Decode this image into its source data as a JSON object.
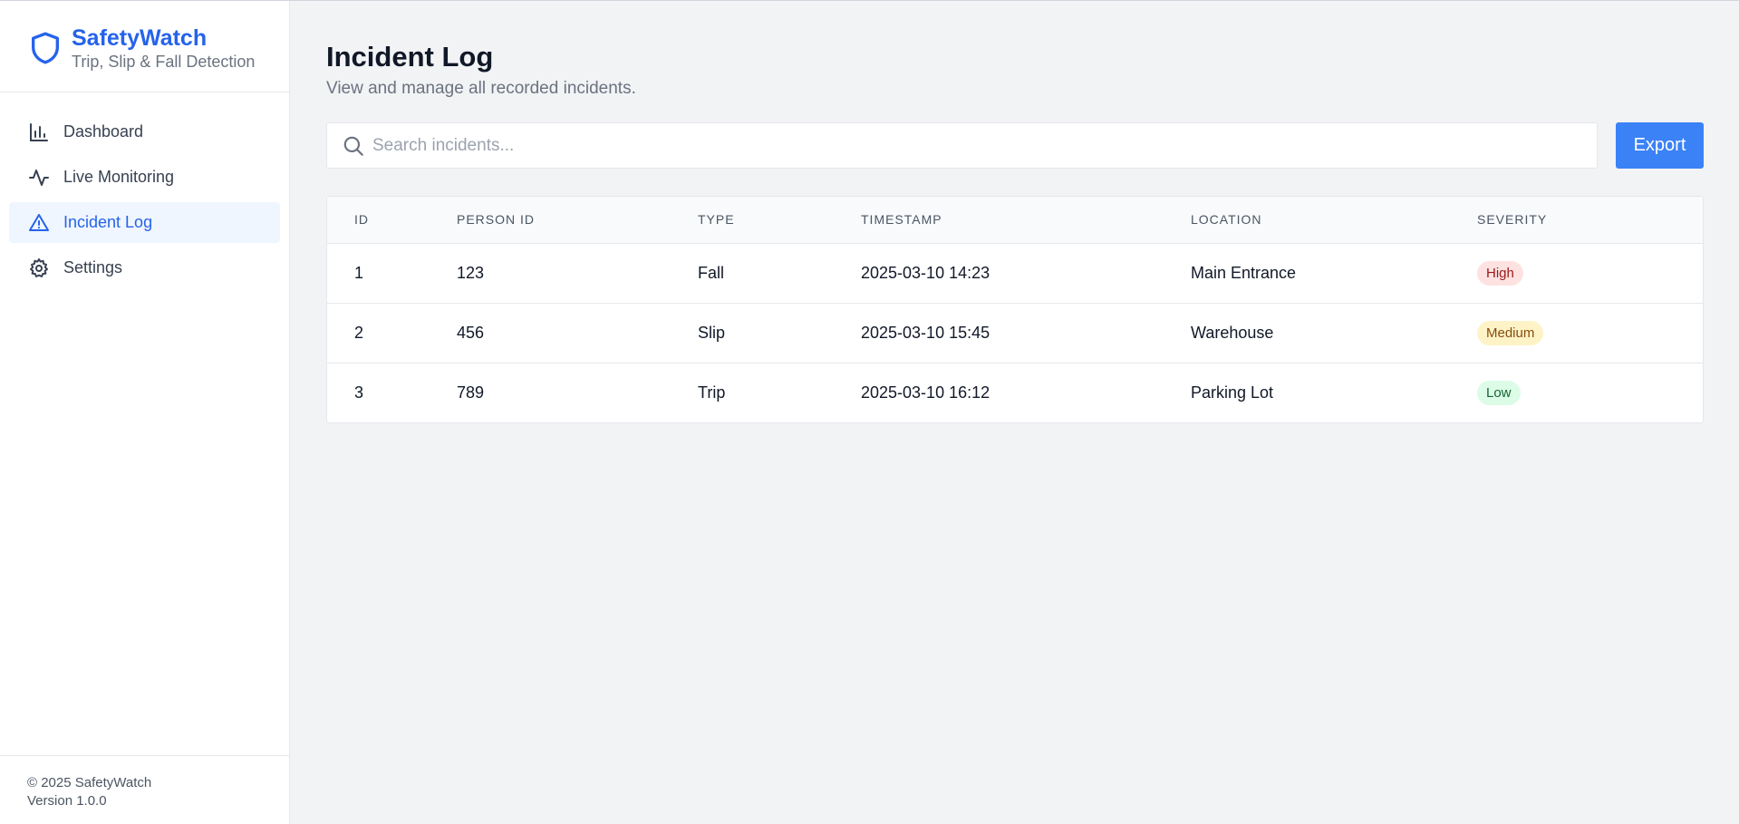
{
  "app": {
    "name": "SafetyWatch",
    "tagline": "Trip, Slip & Fall Detection",
    "brand_color": "#2563eb"
  },
  "sidebar": {
    "items": [
      {
        "label": "Dashboard",
        "icon": "bar-chart-icon",
        "active": false
      },
      {
        "label": "Live Monitoring",
        "icon": "activity-icon",
        "active": false
      },
      {
        "label": "Incident Log",
        "icon": "alert-triangle-icon",
        "active": true
      },
      {
        "label": "Settings",
        "icon": "gear-icon",
        "active": false
      }
    ],
    "footer": {
      "copyright": "© 2025 SafetyWatch",
      "version": "Version 1.0.0"
    }
  },
  "page": {
    "title": "Incident Log",
    "subtitle": "View and manage all recorded incidents."
  },
  "search": {
    "placeholder": "Search incidents...",
    "value": ""
  },
  "toolbar": {
    "export_label": "Export",
    "export_color": "#3b82f6"
  },
  "table": {
    "columns": [
      "ID",
      "PERSON ID",
      "TYPE",
      "TIMESTAMP",
      "LOCATION",
      "SEVERITY"
    ],
    "rows": [
      {
        "id": "1",
        "person_id": "123",
        "type": "Fall",
        "timestamp": "2025-03-10 14:23",
        "location": "Main Entrance",
        "severity": "High"
      },
      {
        "id": "2",
        "person_id": "456",
        "type": "Slip",
        "timestamp": "2025-03-10 15:45",
        "location": "Warehouse",
        "severity": "Medium"
      },
      {
        "id": "3",
        "person_id": "789",
        "type": "Trip",
        "timestamp": "2025-03-10 16:12",
        "location": "Parking Lot",
        "severity": "Low"
      }
    ]
  },
  "severity_colors": {
    "High": {
      "bg": "#fee2e2",
      "fg": "#991b1b"
    },
    "Medium": {
      "bg": "#fef3c7",
      "fg": "#854d0e"
    },
    "Low": {
      "bg": "#dcfce7",
      "fg": "#166534"
    }
  }
}
